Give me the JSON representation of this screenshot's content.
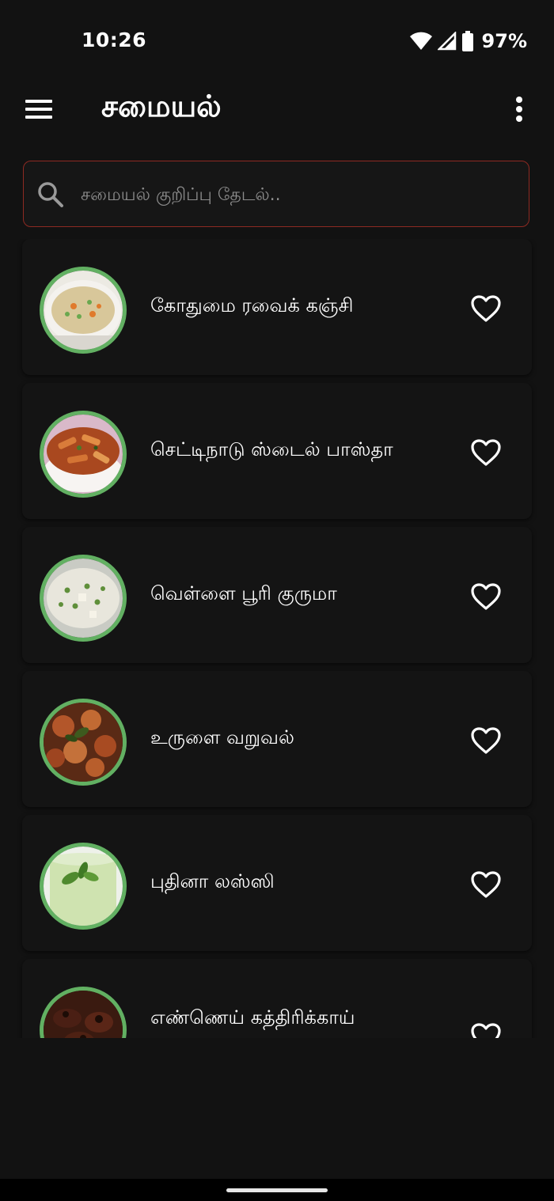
{
  "status_bar": {
    "time": "10:26",
    "battery_pct": "97%",
    "icons": [
      "wifi-icon",
      "cell-signal-icon",
      "battery-icon"
    ]
  },
  "app_bar": {
    "title": "சமையல்",
    "menu_icon": "hamburger-menu-icon",
    "overflow_icon": "more-vert-icon"
  },
  "search": {
    "placeholder": "சமையல் குறிப்பு தேடல்..",
    "value": "",
    "border_color": "#8e2a22"
  },
  "recipes": [
    {
      "name": "கோதுமை ரவைக் கஞ்சி",
      "favorite": false,
      "thumb": "porridge"
    },
    {
      "name": "செட்டிநாடு ஸ்டைல் பாஸ்தா",
      "favorite": false,
      "thumb": "pasta"
    },
    {
      "name": "வெள்ளை பூரி குருமா",
      "favorite": false,
      "thumb": "kurma"
    },
    {
      "name": "உருளை வறுவல்",
      "favorite": false,
      "thumb": "potato-fry"
    },
    {
      "name": "புதினா லஸ்ஸி",
      "favorite": false,
      "thumb": "mint-lassi"
    },
    {
      "name": "எண்ணெய் கத்திரிக்காய்",
      "favorite": false,
      "thumb": "brinjal"
    }
  ],
  "colors": {
    "background": "#121212",
    "card": "#141414",
    "thumb_ring": "#62b062",
    "text": "#ffffff"
  }
}
